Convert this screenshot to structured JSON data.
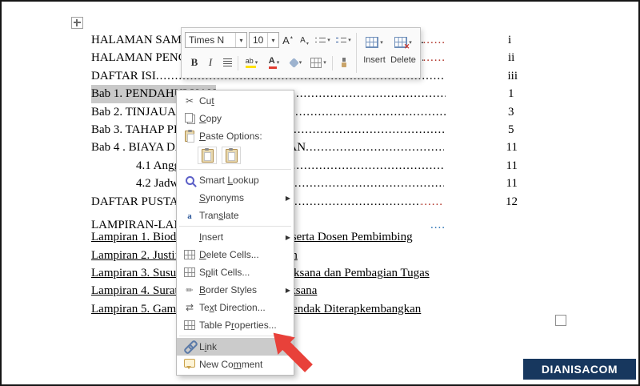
{
  "toc": {
    "entries": [
      {
        "text": "HALAMAN SAMPUL",
        "page": "i"
      },
      {
        "text": "HALAMAN PENGESAHAN",
        "page": "ii"
      },
      {
        "text": "DAFTAR ISI",
        "page": "iii"
      },
      {
        "text": "Bab 1. PENDAHULUAN",
        "page": "1"
      },
      {
        "text": "Bab 2. TINJAUAN PUSTAKA",
        "page": "3"
      },
      {
        "text": "Bab 3. TAHAP PELAKSANAAN",
        "page": "5"
      },
      {
        "text": "Bab 4 . BIAYA DAN JADWAL KEGIATAN",
        "page": "11"
      },
      {
        "text": "4.1 Anggaran Biaya",
        "page": "11"
      },
      {
        "text": "4.2 Jadwal Kegiatan",
        "page": "11"
      },
      {
        "text": "DAFTAR PUSTAKA",
        "page": "12"
      },
      {
        "text": "LAMPIRAN-LAMPIRAN",
        "page": ""
      },
      {
        "text": "Lampiran 1. Biodata Ketua dan Anggota, serta Dosen Pembimbing",
        "page": ""
      },
      {
        "text": "Lampiran 2. Justifikasi Anggaran Kegiatan",
        "page": ""
      },
      {
        "text": "Lampiran 3. Susunan Organisasi Tim Pelaksana dan Pembagian Tugas",
        "page": ""
      },
      {
        "text": "Lampiran 4. Surat Pernyataan Ketua Pelaksana",
        "page": ""
      },
      {
        "text": "Lampiran 5. Gambaran Teknologi yang Hendak Diterapkembangkan",
        "page": ""
      }
    ]
  },
  "mini_toolbar": {
    "font_name": "Times N",
    "font_size": "10",
    "grow_font": "A",
    "shrink_font": "A",
    "bold": "B",
    "italic": "I",
    "highlight": "ab",
    "font_color": "A",
    "insert_label": "Insert",
    "delete_label": "Delete"
  },
  "context_menu": {
    "items": [
      {
        "pre": "Cu",
        "accel": "t",
        "post": ""
      },
      {
        "pre": "",
        "accel": "C",
        "post": "opy"
      },
      {
        "pre": "",
        "accel": "P",
        "post": "aste Options:"
      },
      {
        "pre": "Smart ",
        "accel": "L",
        "post": "ookup"
      },
      {
        "pre": "",
        "accel": "S",
        "post": "ynonyms"
      },
      {
        "pre": "Tran",
        "accel": "s",
        "post": "late"
      },
      {
        "pre": "",
        "accel": "I",
        "post": "nsert"
      },
      {
        "pre": "",
        "accel": "D",
        "post": "elete Cells..."
      },
      {
        "pre": "S",
        "accel": "p",
        "post": "lit Cells..."
      },
      {
        "pre": "",
        "accel": "B",
        "post": "order Styles"
      },
      {
        "pre": "Te",
        "accel": "x",
        "post": "t Direction..."
      },
      {
        "pre": "Table P",
        "accel": "r",
        "post": "operties..."
      },
      {
        "pre": "L",
        "accel": "i",
        "post": "nk"
      },
      {
        "pre": "New Co",
        "accel": "m",
        "post": "ment"
      }
    ]
  },
  "watermark": {
    "text": "DIANISACOM"
  }
}
